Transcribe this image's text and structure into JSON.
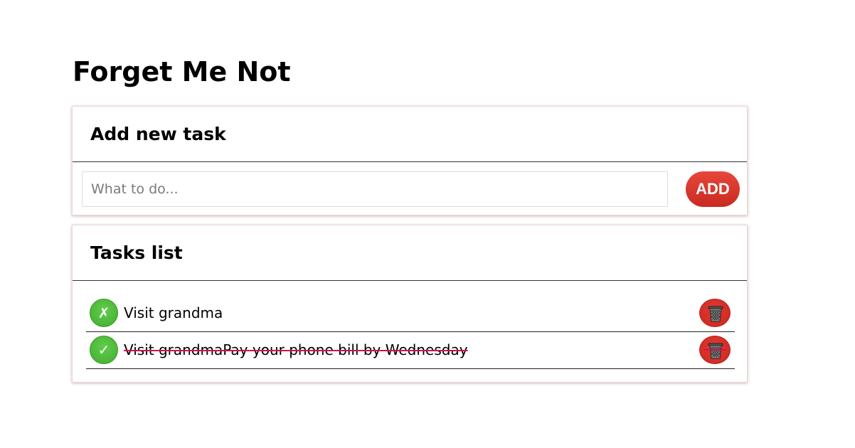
{
  "app": {
    "title": "Forget Me Not"
  },
  "add_task": {
    "heading": "Add new task",
    "input_placeholder": "What to do...",
    "input_value": "",
    "add_label": "ADD"
  },
  "tasks_list": {
    "heading": "Tasks list",
    "items": [
      {
        "text": "Visit grandma",
        "done": false,
        "check_icon": "✗",
        "delete_icon": "trash-icon"
      },
      {
        "text": "Visit grandmaPay your phone bill by Wednesday",
        "done": true,
        "check_icon": "✓",
        "delete_icon": "trash-icon"
      }
    ]
  },
  "colors": {
    "accent_red": "#d9352b",
    "accent_green": "#4cbb3a",
    "strike_color": "#d3124a"
  }
}
